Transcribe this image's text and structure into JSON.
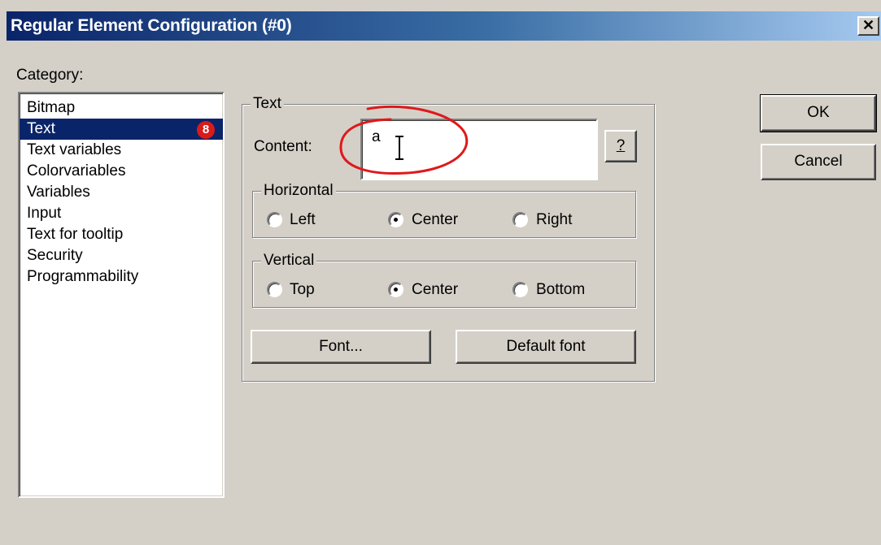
{
  "window": {
    "title": "Regular Element Configuration (#0)",
    "close_glyph": "✕"
  },
  "category": {
    "label": "Category:",
    "items": [
      {
        "label": "Bitmap",
        "selected": false
      },
      {
        "label": "Text",
        "selected": true
      },
      {
        "label": "Text variables",
        "selected": false
      },
      {
        "label": "Colorvariables",
        "selected": false
      },
      {
        "label": "Variables",
        "selected": false
      },
      {
        "label": "Input",
        "selected": false
      },
      {
        "label": "Text for tooltip",
        "selected": false
      },
      {
        "label": "Security",
        "selected": false
      },
      {
        "label": "Programmability",
        "selected": false
      }
    ],
    "step_badge": "8"
  },
  "text_group": {
    "title": "Text",
    "content_label": "Content:",
    "content_value": "a",
    "help_button": "?"
  },
  "horizontal": {
    "title": "Horizontal",
    "options": [
      "Left",
      "Center",
      "Right"
    ],
    "selected": "Center"
  },
  "vertical": {
    "title": "Vertical",
    "options": [
      "Top",
      "Center",
      "Bottom"
    ],
    "selected": "Center"
  },
  "buttons": {
    "font": "Font...",
    "default_font": "Default font",
    "ok": "OK",
    "cancel": "Cancel"
  },
  "colors": {
    "dialog_bg": "#d4d0c8",
    "title_gradient_start": "#0a246a",
    "title_gradient_end": "#a6caf0",
    "selection": "#0a246a",
    "annotation": "#e0181b"
  },
  "icons": [
    "close-icon",
    "text-cursor-icon",
    "step-badge-icon"
  ]
}
